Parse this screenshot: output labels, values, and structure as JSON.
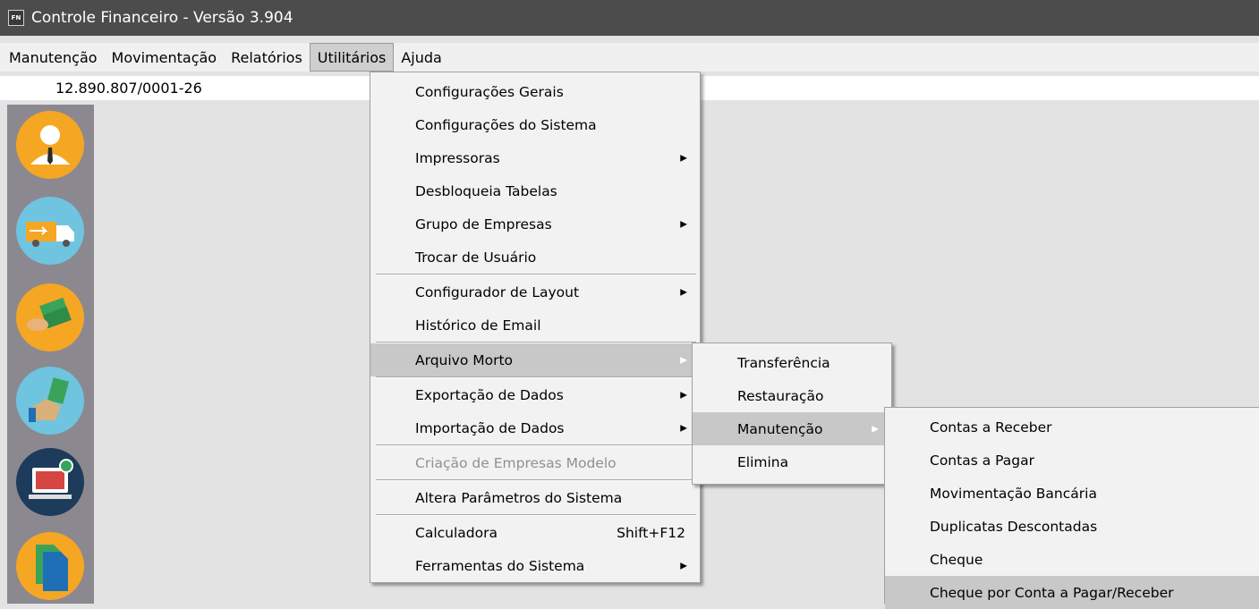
{
  "window": {
    "title": "Controle Financeiro - Versão 3.904",
    "icon_label": "FN"
  },
  "menubar": {
    "items": [
      "Manutenção",
      "Movimentação",
      "Relatórios",
      "Utilitários",
      "Ajuda"
    ],
    "active": "Utilitários"
  },
  "info": {
    "cnpj": "12.890.807/0001-26"
  },
  "sidebar": {
    "icons": [
      "user-icon",
      "delivery-truck-icon",
      "money-exchange-icon",
      "payment-hand-icon",
      "computer-screen-icon",
      "documents-icon"
    ]
  },
  "utilitarios_menu": {
    "items": [
      {
        "label": "Configurações Gerais"
      },
      {
        "label": "Configurações do Sistema"
      },
      {
        "label": "Impressoras",
        "submenu": true
      },
      {
        "label": "Desbloqueia Tabelas"
      },
      {
        "label": "Grupo de Empresas",
        "submenu": true
      },
      {
        "label": "Trocar de Usuário"
      },
      {
        "label": "Configurador de Layout",
        "submenu": true
      },
      {
        "label": "Histórico de Email"
      },
      {
        "label": "Arquivo Morto",
        "submenu": true,
        "highlighted": true
      },
      {
        "label": "Exportação de Dados",
        "submenu": true
      },
      {
        "label": "Importação de Dados",
        "submenu": true
      },
      {
        "label": "Criação de Empresas Modelo",
        "disabled": true
      },
      {
        "label": "Altera Parâmetros do Sistema"
      },
      {
        "label": "Calculadora",
        "shortcut": "Shift+F12"
      },
      {
        "label": "Ferramentas do Sistema",
        "submenu": true
      }
    ]
  },
  "arquivo_morto_menu": {
    "items": [
      {
        "label": "Transferência"
      },
      {
        "label": "Restauração"
      },
      {
        "label": "Manutenção",
        "submenu": true,
        "highlighted": true
      },
      {
        "label": "Elimina"
      }
    ]
  },
  "manutencao_menu": {
    "items": [
      {
        "label": "Contas a Receber"
      },
      {
        "label": "Contas a Pagar"
      },
      {
        "label": "Movimentação Bancária"
      },
      {
        "label": "Duplicatas Descontadas"
      },
      {
        "label": "Cheque"
      },
      {
        "label": "Cheque por Conta a Pagar/Receber",
        "highlighted": true
      }
    ]
  },
  "colors": {
    "titlebar": "#4c4c4c",
    "sidebar": "#8c8890",
    "menu_bg": "#f2f2f2",
    "highlight": "#c8c8c8",
    "disabled_text": "#909090"
  }
}
